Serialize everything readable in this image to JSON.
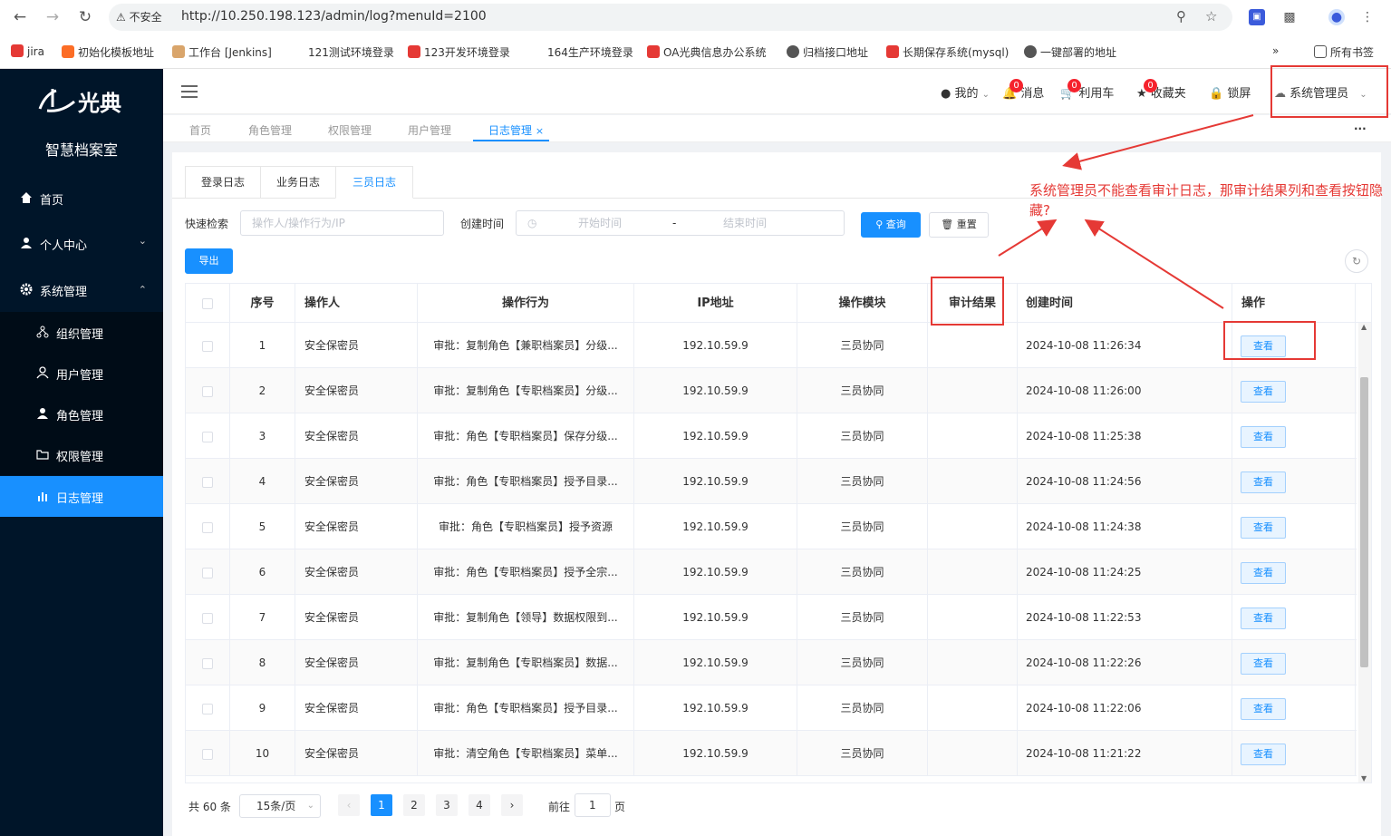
{
  "browser": {
    "insecure_label": "不安全",
    "url": "http://10.250.198.123/admin/log?menuId=2100",
    "bookmarks": [
      "jira",
      "初始化模板地址",
      "工作台 [Jenkins]",
      "121测试环境登录",
      "123开发环境登录",
      "164生产环境登录",
      "OA光典信息办公系统",
      "归档接口地址",
      "长期保存系统(mysql)",
      "一键部署的地址"
    ],
    "all_bookmarks": "所有书签"
  },
  "sidebar": {
    "logo_text": "光典",
    "app_name": "智慧档案室",
    "items": [
      {
        "label": "首页"
      },
      {
        "label": "个人中心"
      },
      {
        "label": "系统管理"
      },
      {
        "label": "组织管理"
      },
      {
        "label": "用户管理"
      },
      {
        "label": "角色管理"
      },
      {
        "label": "权限管理"
      },
      {
        "label": "日志管理"
      }
    ]
  },
  "header": {
    "mine": "我的",
    "messages": "消息",
    "messages_count": "0",
    "cart": "利用车",
    "cart_count": "0",
    "favorites": "收藏夹",
    "favorites_count": "0",
    "lock": "锁屏",
    "user": "系统管理员"
  },
  "tabs": [
    "首页",
    "角色管理",
    "权限管理",
    "用户管理",
    "日志管理"
  ],
  "subtabs": [
    "登录日志",
    "业务日志",
    "三员日志"
  ],
  "filters": {
    "quick_search_label": "快速检索",
    "quick_search_placeholder": "操作人/操作行为/IP",
    "created_label": "创建时间",
    "start_placeholder": "开始时间",
    "range_sep": "-",
    "end_placeholder": "结束时间",
    "query_btn": "查询",
    "reset_btn": "重置",
    "export_btn": "导出"
  },
  "table": {
    "headers": [
      "序号",
      "操作人",
      "操作行为",
      "IP地址",
      "操作模块",
      "审计结果",
      "创建时间",
      "操作"
    ],
    "view_label": "查看",
    "rows": [
      {
        "no": "1",
        "user": "安全保密员",
        "action": "审批：复制角色【兼职档案员】分级...",
        "ip": "192.10.59.9",
        "module": "三员协同",
        "audit": "",
        "time": "2024-10-08 11:26:34"
      },
      {
        "no": "2",
        "user": "安全保密员",
        "action": "审批：复制角色【专职档案员】分级...",
        "ip": "192.10.59.9",
        "module": "三员协同",
        "audit": "",
        "time": "2024-10-08 11:26:00"
      },
      {
        "no": "3",
        "user": "安全保密员",
        "action": "审批：角色【专职档案员】保存分级...",
        "ip": "192.10.59.9",
        "module": "三员协同",
        "audit": "",
        "time": "2024-10-08 11:25:38"
      },
      {
        "no": "4",
        "user": "安全保密员",
        "action": "审批：角色【专职档案员】授予目录...",
        "ip": "192.10.59.9",
        "module": "三员协同",
        "audit": "",
        "time": "2024-10-08 11:24:56"
      },
      {
        "no": "5",
        "user": "安全保密员",
        "action": "审批：角色【专职档案员】授予资源",
        "ip": "192.10.59.9",
        "module": "三员协同",
        "audit": "",
        "time": "2024-10-08 11:24:38"
      },
      {
        "no": "6",
        "user": "安全保密员",
        "action": "审批：角色【专职档案员】授予全宗...",
        "ip": "192.10.59.9",
        "module": "三员协同",
        "audit": "",
        "time": "2024-10-08 11:24:25"
      },
      {
        "no": "7",
        "user": "安全保密员",
        "action": "审批：复制角色【领导】数据权限到...",
        "ip": "192.10.59.9",
        "module": "三员协同",
        "audit": "",
        "time": "2024-10-08 11:22:53"
      },
      {
        "no": "8",
        "user": "安全保密员",
        "action": "审批：复制角色【专职档案员】数据...",
        "ip": "192.10.59.9",
        "module": "三员协同",
        "audit": "",
        "time": "2024-10-08 11:22:26"
      },
      {
        "no": "9",
        "user": "安全保密员",
        "action": "审批：角色【专职档案员】授予目录...",
        "ip": "192.10.59.9",
        "module": "三员协同",
        "audit": "",
        "time": "2024-10-08 11:22:06"
      },
      {
        "no": "10",
        "user": "安全保密员",
        "action": "审批：清空角色【专职档案员】菜单...",
        "ip": "192.10.59.9",
        "module": "三员协同",
        "audit": "",
        "time": "2024-10-08 11:21:22"
      }
    ]
  },
  "pagination": {
    "total": "共 60 条",
    "page_size": "15条/页",
    "pages": [
      "1",
      "2",
      "3",
      "4"
    ],
    "goto_label": "前往",
    "goto_value": "1",
    "page_suffix": "页"
  },
  "annotation": "系统管理员不能查看审计日志，那审计结果列和查看按钮隐藏?",
  "colors": {
    "accent": "#1890ff",
    "sidebar": "#001529",
    "annotation": "#e53935"
  }
}
